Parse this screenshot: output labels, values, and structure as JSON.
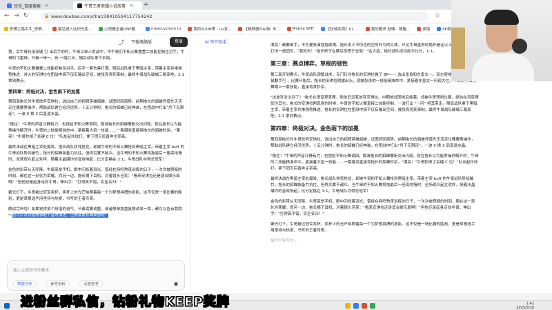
{
  "browser": {
    "tabs": [
      {
        "label": "豆包_百度搜索",
        "color": "#3b7cff"
      },
      {
        "label": "牛哥王者荣耀小说故事",
        "color": "#222222"
      }
    ],
    "url": "www.doubao.com/chat/38410594117754242",
    "bookmarks": [
      "恐惧之路牛牛_恐俱...",
      "激活进入比织光免...",
      "心悦霸王者DNF器...",
      "mesocyclone (o",
      "我的SUUB等 - uu发...",
      "【精屏德ISAI特: 专...",
      "Mobile WiFi",
      "【权域实现】01 ...",
      "我的要求 就储 - 随箱...",
      "读借",
      "PP视频在线观看_免..."
    ]
  },
  "left": {
    "share_icon": "share-icon",
    "download_label": "下载电脑版",
    "login_label": "登录",
    "paragraphs": [
      "第，后牛哥利用双键 打 出后手的时，牛哥以单人的战中，中牛哥们不知火舞撸置二技能控制住对手，牛哥的飞雷神，节奏一带一，传 一路打出，随后战队拿下本局。",
      "牛哥的不知火舞撸置二技能控制住对手，后手一套伤害打满，随后战队拿下黑暗主宰，带着主宰兵推强势推进，并火的安琪拉在团战中极不仅有输出空间，被张良亮死牵制。最终牛哥战队破城三路高地，2:1 拿到赛点。"
    ],
    "heading": "第四章：终极对决，金色雨下的加冕",
    "paragraphs2": [
      "第四局拖长时牛哥放弃安琪拉，选出自己的招牌英雄貂蝉，试图抓回局势。前期拖长的貂蝉凭借先天活走位骚要秀操作，帮助战队建立经济优势。十五分钟时，拖长的貂蝉已经神装，在团战中打出\"月下无限连\"，一波 0 换 3 后直逼水晶。",
      "\"稳住！\"牛哥的声音冷静有力，也提给不知火舞调回，稳准拖长的貂蝉撒新交出闪现。就在拖长以为能秀操作解开时，牛哥的二技能精准命中，紧接着大招一技能……一套爆发直接将拖长的貂蝉秒杀。\"漂亮！\"牛哥秒掉了关键 C 位！\"队友起扑炫打，拿下团灭后直奔主宰高。",
      "最终决战在黑暗主宰处爆发。拖长战队拼死抢龙，却被牛哥的不知火舞抢到黑暗主宰。带着主宰 buff 的牛哥战队势如破竹，拖长的貂蝉装备力抗住，但终究寡不敌众。当牛哥的不知火舞将拖最后一座高地墙时，全场观众起立欢呼，随着水晶爆炸的音效响起，比分定格在 3:1，牛哥战队夺得总冠军！",
      "金色的彩带从天而降，牛哥高举手机，眼中闪烁着泪光。曾经在网吧熬夜训练的日子，一次次被质疑的时刻，都在这一刻化为荣耀。而另一边，拖长摘下耳机，对着镜头苦笑：\"看来安琪拉还是适合娱乐局啊！\"但他还是起身走向牛哥，伸出手：\"打得真不错，实至名归！\"",
      "聚光灯下，牛哥被过冠军奖杯，奖杯上的光芒映照着每一个为梦想拼搏的身影。这不仅是一场比赛的胜利，更是草根选手用坚持与热爱，书写的王者传奇。",
      "朗读完毕啦！如果觉得某个段落的语气、节奏需要调整，或者想单独重复朗读某一章，都可以告诉我哦～"
    ],
    "highlight": "也可以试试给故事配上音效描述，让朗读更有画面感呢！",
    "composer_placeholder": "输入主题和写作要求",
    "composer_buttons": [
      "帮我写作",
      "参考资料",
      "深度思考"
    ]
  },
  "right": {
    "ai_assist": "AI 写作助手",
    "paragraphs_top": [
      "漂亮！都要单手，不方便表演强拖局限。拖长本人不惊也的空的外为的又体，只见牛哥直奔的局外是让以上分，队友配合打出一波团灭，\"我的天！\"拖长终于在赛后惊慌于全局！\"这大招，拖长战队成功扳平比分，1:1。"
    ],
    "heading3": "第三章：赛点博弈，草根的韧性",
    "paragraphs3": [
      "第三局开到赛点，牛哥战队调整战术，专门针对拖长的安琪拉做了 BP—— 选出张良和东皇太一。双方使体形正安琪拉打得鼠翻手可 ，比赛开始后，拖长的安琪拉刚露出头，就被张良的一技能精准命中，紧接着东皇太一闪现大住，牛哥的不知火舞跟上一套技能，直接将其秒杀。",
      "\"这波针对太到了！\"拖长在语音里哀嚎，但依旧没有放弃安琪拉。中期他试图绕后偷袭，却被牛哥预判位置，提前在河道埋伏住其它。拖长的安琪拉刚现身的时候，牛哥的不知火舞直接二技能控制，一波打出 \"一闪\" 将其带走。随后战队拿下黑暗主宰，带着主宰兵推强势推进，拖长的安琪拉在团战中极不仅有输出空间，被张良亮死牵制。最终牛哥战队破城三路高地，2:1 拿到赛点。"
    ],
    "heading4": "第四章：终极对决，金色雨下的加冕",
    "paragraphs4": [
      "第四局拖长时牛哥放弃安琪拉，选出自己的招牌英雄貂蝉，试图抓回局势。前期拖长的貂蝉凭借先天活走位骚要秀操作，帮助战队建立经济优势。十五分钟时，拖长的貂蝉已经神装，在团战中打出\"月下无限连\"，一波 0 换 3 后直逼水晶。",
      "\"稳住！\"牛哥的声音冷静有力，也提给不知火舞调回，稳准拖长的貂蝉撒新交出闪现。就在拖长以为能秀操作解开时，牛哥的二技能精准命中，紧接着大招一技能……一套爆发直接将拖长的貂蝉秒杀。\"漂亮！\"牛哥秒掉了关键 C 位！\"队友起扑炫打，拿下团灭后直奔主宰高。",
      "最终决战在黑暗主宰处爆发。拖长战队拼死抢龙，却被牛哥的不知火舞抢到黑暗主宰。带着主宰 buff 的牛哥战队势如破竹，拖长的貂蝉装备力抗住，但终究寡不敌众。当牛哥的不知火舞将拖最后一座高地墙时，全场观众起立欢呼，随着水晶爆炸的音效响起，比分定格在 3:1，牛哥战队夺得总冠军！",
      "金色的彩带从天而降，牛哥高举手机，眼中闪烁着泪光。曾经在网吧熬夜训练的日子，一次次被质疑的时刻，都在这一刻化为荣耀。而另一边，拖长摘下耳机，对着镜头苦笑：\"看来安琪拉还是适合娱乐局啊！\"但他还是起身走向牛哥，伸出手：\"打得真不错，实至名归！\"",
      "聚光灯下，牛哥被过冠军奖杯，奖杯上的光芒映照着每一个为梦想拼搏的身影。这不仅是一场比赛的胜利，更是草根选手用坚持与热爱，书写的王者传奇。"
    ],
    "placeholder": "描写引导写作..."
  },
  "caption": "进粉丝群私信，钻粉礼物KEEP奖牌",
  "taskbar": {
    "time": "1:42",
    "date": "2025/5/10"
  }
}
